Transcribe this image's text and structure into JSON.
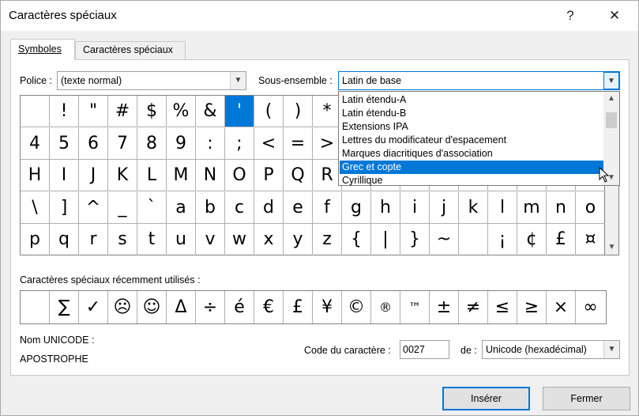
{
  "window": {
    "title": "Caractères spéciaux",
    "help_label": "?",
    "close_label": "✕"
  },
  "tabs": [
    {
      "label": "Symboles",
      "active": true
    },
    {
      "label": "Caractères spéciaux",
      "active": false
    }
  ],
  "font": {
    "label": "Police :",
    "value": "(texte normal)"
  },
  "subset": {
    "label": "Sous-ensemble :",
    "value": "Latin de base"
  },
  "subset_dropdown": {
    "items": [
      "Latin étendu-A",
      "Latin étendu-B",
      "Extensions IPA",
      "Lettres du modificateur d'espacement",
      "Marques diacritiques d'association",
      "Grec et copte",
      "Cyrillique"
    ],
    "selected_index": 5
  },
  "symbol_grid": {
    "rows": [
      [
        "",
        "!",
        "\"",
        "#",
        "$",
        "%",
        "&",
        "'",
        "(",
        ")",
        "*",
        "",
        "",
        "",
        "",
        "",
        "",
        "",
        "",
        ""
      ],
      [
        "4",
        "5",
        "6",
        "7",
        "8",
        "9",
        ":",
        ";",
        "<",
        "=",
        ">",
        "",
        "",
        "",
        "",
        "",
        "",
        "",
        "",
        ""
      ],
      [
        "H",
        "I",
        "J",
        "K",
        "L",
        "M",
        "N",
        "O",
        "P",
        "Q",
        "R",
        "",
        "",
        "",
        "",
        "",
        "",
        "",
        "",
        ""
      ],
      [
        "\\",
        "]",
        "^",
        "_",
        "`",
        "a",
        "b",
        "c",
        "d",
        "e",
        "f",
        "g",
        "h",
        "i",
        "j",
        "k",
        "l",
        "m",
        "n",
        "o"
      ],
      [
        "p",
        "q",
        "r",
        "s",
        "t",
        "u",
        "v",
        "w",
        "x",
        "y",
        "z",
        "{",
        "|",
        "}",
        "~",
        "",
        "¡",
        "¢",
        "£",
        "¤"
      ]
    ],
    "selected": {
      "row": 0,
      "col": 7
    }
  },
  "recent": {
    "label": "Caractères spéciaux récemment utilisés :",
    "chars": [
      "",
      "∑",
      "✓",
      "☹",
      "☺",
      "Δ",
      "÷",
      "é",
      "€",
      "£",
      "¥",
      "©",
      "®",
      "™",
      "±",
      "≠",
      "≤",
      "≥",
      "×",
      "∞"
    ]
  },
  "unicode_name": {
    "label": "Nom UNICODE :",
    "value": "APOSTROPHE"
  },
  "char_code": {
    "label": "Code du caractère :",
    "value": "0027"
  },
  "from": {
    "label": "de :",
    "value": "Unicode (hexadécimal)"
  },
  "buttons": {
    "insert": "Insérer",
    "close": "Fermer"
  },
  "colors": {
    "accent": "#0078d7",
    "dialog_bg": "#f0f0f0"
  }
}
